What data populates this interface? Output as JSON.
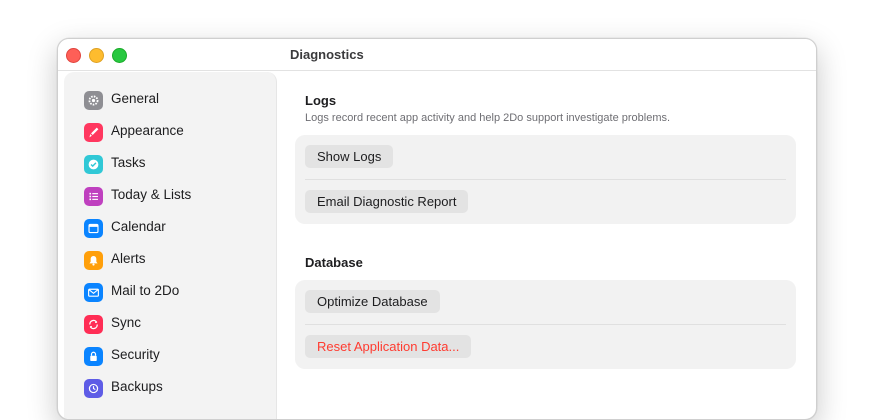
{
  "window": {
    "title": "Diagnostics"
  },
  "sidebar": {
    "items": [
      {
        "label": "General",
        "icon": "gear-icon",
        "color": "#8e8e93"
      },
      {
        "label": "Appearance",
        "icon": "paintbrush-icon",
        "color": "#ff375f"
      },
      {
        "label": "Tasks",
        "icon": "checkmark-circle-icon",
        "color": "#30c8d6"
      },
      {
        "label": "Today & Lists",
        "icon": "list-icon",
        "color": "#bf40bf"
      },
      {
        "label": "Calendar",
        "icon": "calendar-icon",
        "color": "#0a84ff"
      },
      {
        "label": "Alerts",
        "icon": "bell-icon",
        "color": "#ff9f0a"
      },
      {
        "label": "Mail to 2Do",
        "icon": "envelope-icon",
        "color": "#0a84ff"
      },
      {
        "label": "Sync",
        "icon": "sync-icon",
        "color": "#ff2d55"
      },
      {
        "label": "Security",
        "icon": "lock-icon",
        "color": "#0a84ff"
      },
      {
        "label": "Backups",
        "icon": "clock-icon",
        "color": "#5e5ce6"
      }
    ]
  },
  "logs": {
    "title": "Logs",
    "description": "Logs record recent app activity and help 2Do support investigate problems.",
    "show_logs_label": "Show Logs",
    "email_report_label": "Email Diagnostic Report"
  },
  "database": {
    "title": "Database",
    "optimize_label": "Optimize Database",
    "reset_label": "Reset Application Data..."
  }
}
